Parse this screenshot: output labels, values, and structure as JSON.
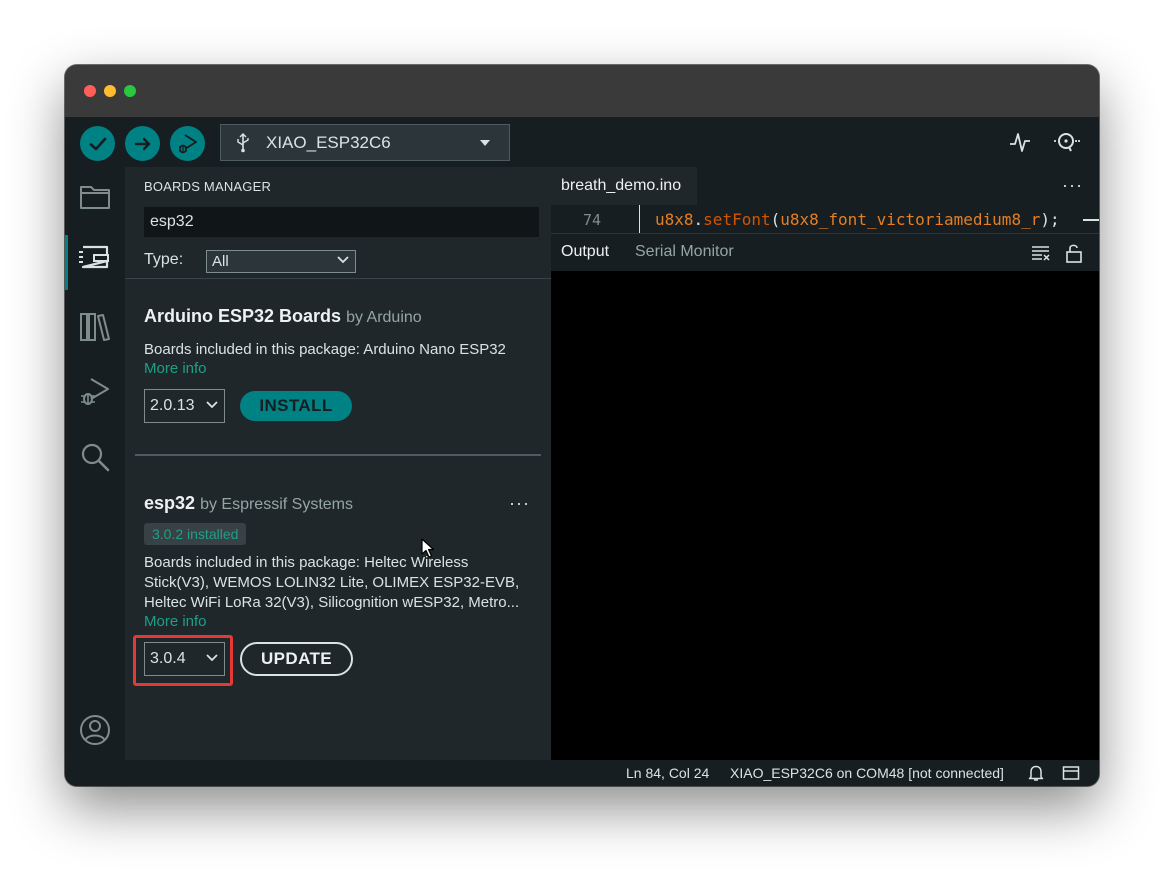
{
  "toolbar": {
    "board_name": "XIAO_ESP32C6"
  },
  "boards_manager": {
    "title": "BOARDS MANAGER",
    "search_value": "esp32",
    "type_label": "Type:",
    "type_value": "All",
    "packages": [
      {
        "name": "Arduino ESP32 Boards",
        "by": "by Arduino",
        "description": "Boards included in this package: Arduino Nano ESP32",
        "more_info": "More info",
        "version": "2.0.13",
        "action": "INSTALL"
      },
      {
        "name": "esp32",
        "by": "by Espressif Systems",
        "installed_badge": "3.0.2 installed",
        "description": "Boards included in this package: Heltec Wireless Stick(V3), WEMOS LOLIN32 Lite, OLIMEX ESP32-EVB, Heltec WiFi LoRa 32(V3), Silicognition wESP32, Metro...",
        "more_info": "More info",
        "version": "3.0.4",
        "action": "UPDATE",
        "more_menu": "···"
      }
    ]
  },
  "editor": {
    "tab_name": "breath_demo.ino",
    "tab_menu": "···",
    "line_number": "74",
    "code": {
      "ident": "u8x8",
      "dot": ".",
      "func": "setFont",
      "open": "(",
      "arg": "u8x8_font_victoriamedium8_r",
      "close": ");"
    }
  },
  "output_panel": {
    "tabs": [
      "Output",
      "Serial Monitor"
    ]
  },
  "statusbar": {
    "position": "Ln 84, Col 24",
    "board_status": "XIAO_ESP32C6 on COM48 [not connected]"
  },
  "colors": {
    "accent": "#008184",
    "link": "#1da086",
    "highlight": "#e53935"
  }
}
